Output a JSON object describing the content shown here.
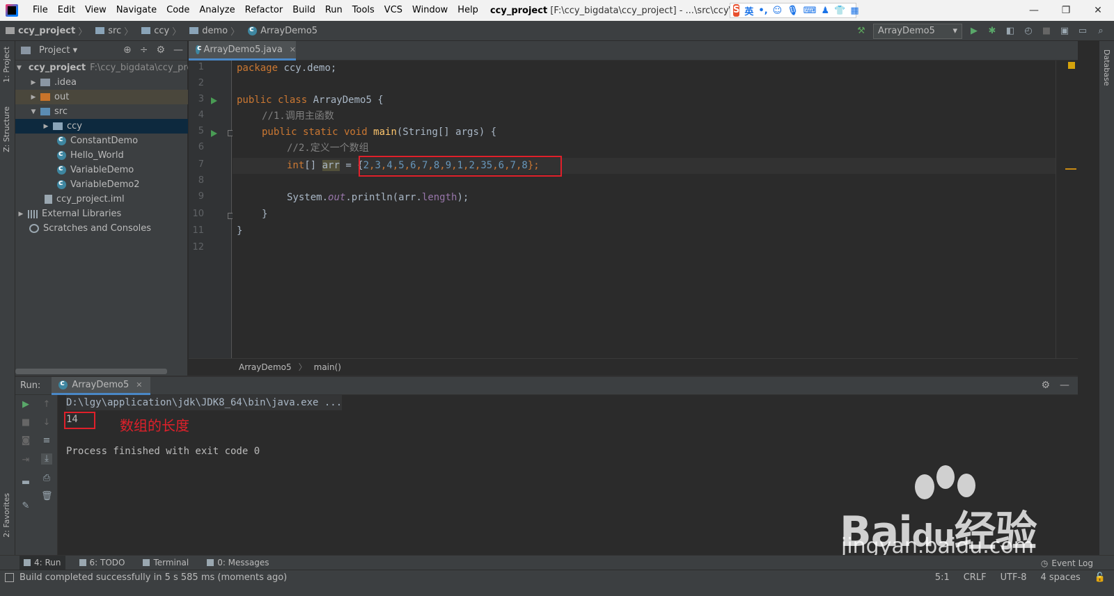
{
  "titlebar": {
    "menu": [
      "File",
      "Edit",
      "View",
      "Navigate",
      "Code",
      "Analyze",
      "Refactor",
      "Build",
      "Run",
      "Tools",
      "VCS",
      "Window",
      "Help"
    ],
    "project_name": "ccy_project",
    "path": "[F:\\ccy_bigdata\\ccy_project] - ...\\src\\ccy\\demo\\Arr",
    "ime_logo": "S",
    "ime_mode": "英",
    "ime_punct": "•,"
  },
  "breadcrumb": [
    "ccy_project",
    "src",
    "ccy",
    "demo",
    "ArrayDemo5"
  ],
  "run_config": "ArrayDemo5",
  "side_tabs": {
    "project": "1: Project",
    "structure": "Z: Structure",
    "favorites": "2: Favorites",
    "database": "Database"
  },
  "project_panel": {
    "title": "Project",
    "tree": [
      {
        "label": "ccy_project",
        "extra": "F:\\ccy_bigdata\\ccy_pro",
        "kind": "root"
      },
      {
        "label": ".idea",
        "kind": "folder"
      },
      {
        "label": "out",
        "kind": "folder-out"
      },
      {
        "label": "src",
        "kind": "folder-src"
      },
      {
        "label": "ccy",
        "kind": "package"
      },
      {
        "label": "ConstantDemo",
        "kind": "class"
      },
      {
        "label": "Hello_World",
        "kind": "class"
      },
      {
        "label": "VariableDemo",
        "kind": "class"
      },
      {
        "label": "VariableDemo2",
        "kind": "class"
      },
      {
        "label": "ccy_project.iml",
        "kind": "iml"
      },
      {
        "label": "External Libraries",
        "kind": "libs"
      },
      {
        "label": "Scratches and Consoles",
        "kind": "scratch"
      }
    ]
  },
  "editor": {
    "tab": "ArrayDemo5.java",
    "line_numbers": [
      "1",
      "2",
      "3",
      "4",
      "5",
      "6",
      "7",
      "8",
      "9",
      "10",
      "11",
      "12"
    ],
    "code": {
      "l1_kw": "package",
      "l1_rest": " ccy.demo;",
      "l3_kw": "public class",
      "l3_rest": " ArrayDemo5 {",
      "l4_comment": "//1.调用主函数",
      "l5_kw": "public static void",
      "l5_fn": "main",
      "l5_rest": "(String[] args) {",
      "l6_comment": "//2.定义一个数组",
      "l7_kw": "int",
      "l7_brackets": "[] ",
      "l7_var": "arr",
      "l7_eq": " = {",
      "l7_values": [
        "2",
        "3",
        "4",
        "5",
        "6",
        "7",
        "8",
        "9",
        "1",
        "2",
        "35",
        "6",
        "7",
        "8"
      ],
      "l7_end": "};",
      "l9_sys": "System.",
      "l9_out": "out",
      "l9_println": ".println(arr.",
      "l9_length": "length",
      "l9_end": ");",
      "l10": "}",
      "l11": "}"
    },
    "crumbs": [
      "ArrayDemo5",
      "main()"
    ]
  },
  "run_panel": {
    "label": "Run:",
    "tab": "ArrayDemo5",
    "console": {
      "command": "D:\\lgy\\application\\jdk\\JDK8_64\\bin\\java.exe ...",
      "output": "14",
      "finished": "Process finished with exit code 0"
    },
    "annotation": "数组的长度"
  },
  "watermark": {
    "brand": "Bai",
    "brand_du": "du",
    "jingyan": "经验",
    "url": "jingyan.baidu.com"
  },
  "bottom_bar": [
    {
      "label": "4: Run"
    },
    {
      "label": "6: TODO"
    },
    {
      "label": "Terminal"
    },
    {
      "label": "0: Messages"
    }
  ],
  "event_log": "Event Log",
  "status": {
    "message": "Build completed successfully in 5 s 585 ms (moments ago)",
    "position": "5:1",
    "line_sep": "CRLF",
    "encoding": "UTF-8",
    "indent": "4 spaces"
  }
}
